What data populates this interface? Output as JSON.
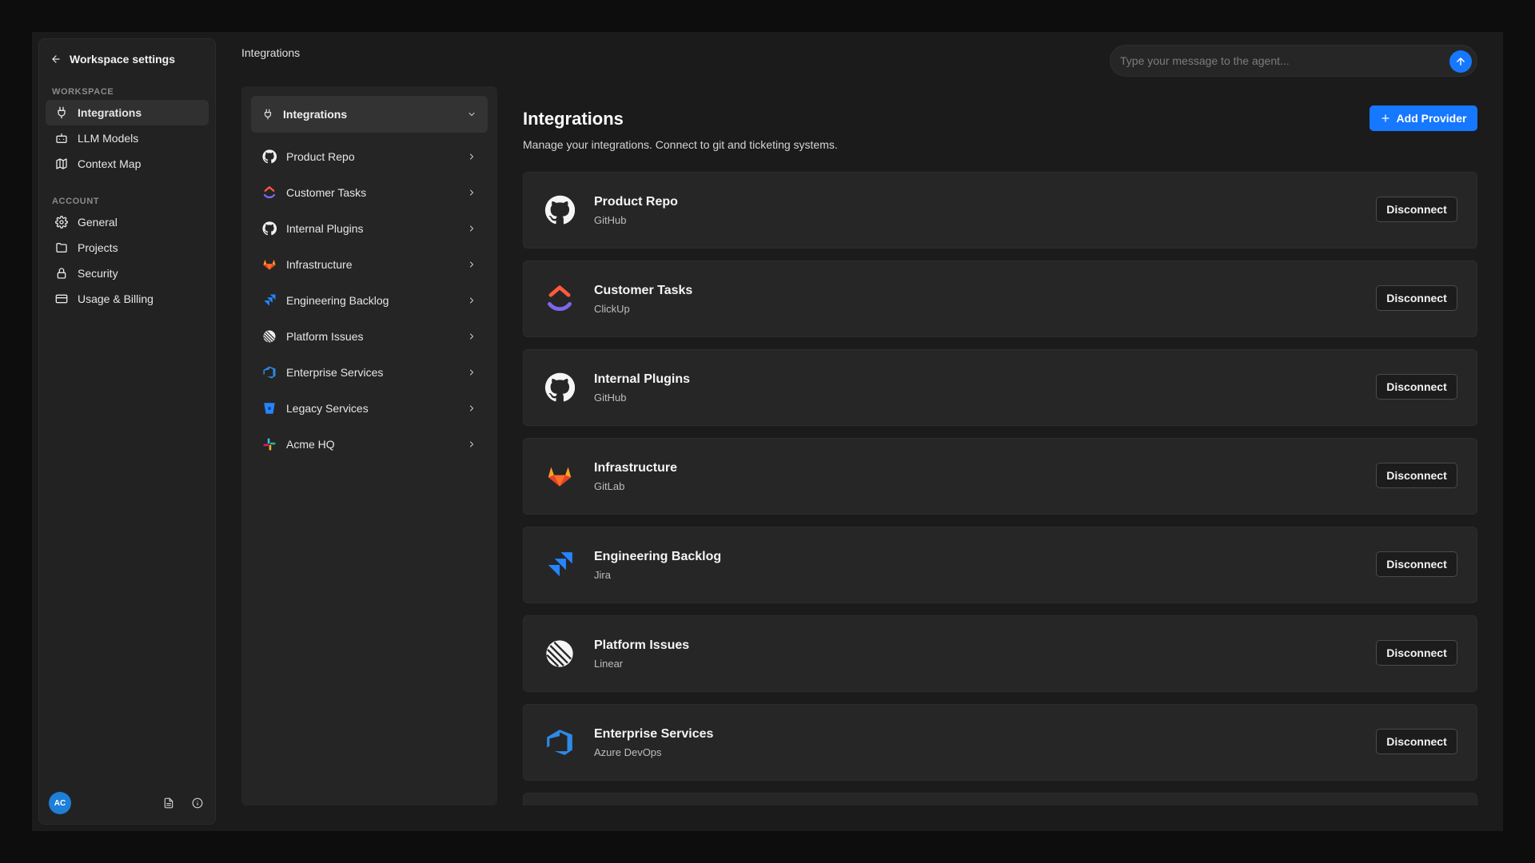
{
  "sidebar": {
    "back_label": "Workspace settings",
    "workspace_section": "WORKSPACE",
    "workspace_items": [
      {
        "label": "Integrations",
        "icon": "plug-icon"
      },
      {
        "label": "LLM Models",
        "icon": "robot-icon"
      },
      {
        "label": "Context Map",
        "icon": "map-icon"
      }
    ],
    "account_section": "ACCOUNT",
    "account_items": [
      {
        "label": "General",
        "icon": "gear-icon"
      },
      {
        "label": "Projects",
        "icon": "folder-icon"
      },
      {
        "label": "Security",
        "icon": "lock-icon"
      },
      {
        "label": "Usage & Billing",
        "icon": "credit-card-icon"
      }
    ],
    "avatar_initials": "AC"
  },
  "header": {
    "breadcrumb": "Integrations",
    "agent_placeholder": "Type your message to the agent..."
  },
  "list_panel": {
    "header_label": "Integrations",
    "items": [
      {
        "label": "Product Repo",
        "icon": "github-icon"
      },
      {
        "label": "Customer Tasks",
        "icon": "clickup-icon"
      },
      {
        "label": "Internal Plugins",
        "icon": "github-icon"
      },
      {
        "label": "Infrastructure",
        "icon": "gitlab-icon"
      },
      {
        "label": "Engineering Backlog",
        "icon": "jira-icon"
      },
      {
        "label": "Platform Issues",
        "icon": "linear-icon"
      },
      {
        "label": "Enterprise Services",
        "icon": "azure-devops-icon"
      },
      {
        "label": "Legacy Services",
        "icon": "bitbucket-icon"
      },
      {
        "label": "Acme HQ",
        "icon": "slack-icon"
      }
    ]
  },
  "main": {
    "title": "Integrations",
    "subtitle": "Manage your integrations. Connect to git and ticketing systems.",
    "add_button_label": "Add Provider",
    "disconnect_label": "Disconnect",
    "cards": [
      {
        "name": "Product Repo",
        "provider": "GitHub",
        "icon": "github-icon"
      },
      {
        "name": "Customer Tasks",
        "provider": "ClickUp",
        "icon": "clickup-icon"
      },
      {
        "name": "Internal Plugins",
        "provider": "GitHub",
        "icon": "github-icon"
      },
      {
        "name": "Infrastructure",
        "provider": "GitLab",
        "icon": "gitlab-icon"
      },
      {
        "name": "Engineering Backlog",
        "provider": "Jira",
        "icon": "jira-icon"
      },
      {
        "name": "Platform Issues",
        "provider": "Linear",
        "icon": "linear-icon"
      },
      {
        "name": "Enterprise Services",
        "provider": "Azure DevOps",
        "icon": "azure-devops-icon"
      }
    ]
  },
  "colors": {
    "accent": "#1677ff",
    "background": "#1b1b1b",
    "panel": "#252525"
  }
}
